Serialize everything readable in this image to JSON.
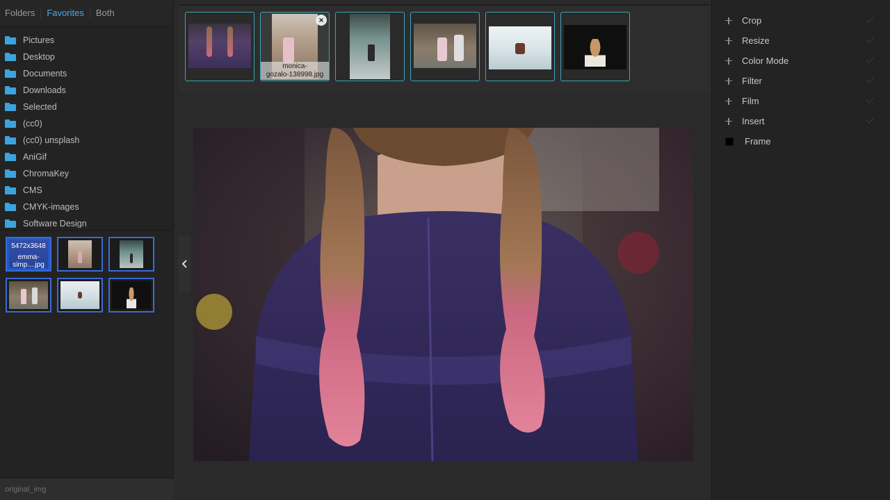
{
  "sidebar": {
    "tabs": [
      {
        "label": "Folders"
      },
      {
        "label": "Favorites"
      },
      {
        "label": "Both"
      }
    ],
    "active_tab": "Favorites",
    "folders": [
      {
        "label": "Pictures"
      },
      {
        "label": "Desktop"
      },
      {
        "label": "Documents"
      },
      {
        "label": "Downloads"
      },
      {
        "label": "Selected"
      },
      {
        "label": "(cc0)"
      },
      {
        "label": "(cc0) unsplash"
      },
      {
        "label": "AniGif"
      },
      {
        "label": "ChromaKey"
      },
      {
        "label": "CMS"
      },
      {
        "label": "CMYK-images"
      },
      {
        "label": "Software Design"
      }
    ],
    "favorites": {
      "selected_dimensions": "5472x3648",
      "selected_name": "emma-simp....jpg"
    },
    "status": "original_img"
  },
  "filmstrip": {
    "hover_caption_1": "monica-",
    "hover_caption_2": "gozalo-138998.jpg",
    "close_glyph": "×"
  },
  "right_panel": {
    "tools": [
      {
        "label": "Crop",
        "icon": "plus-icon"
      },
      {
        "label": "Resize",
        "icon": "plus-icon"
      },
      {
        "label": "Color Mode",
        "icon": "plus-icon"
      },
      {
        "label": "Filter",
        "icon": "plus-icon"
      },
      {
        "label": "Film",
        "icon": "plus-icon"
      },
      {
        "label": "Insert",
        "icon": "plus-icon"
      },
      {
        "label": "Frame",
        "icon": "black-square-icon"
      }
    ]
  },
  "colors": {
    "accent": "#4aa9e8",
    "folder": "#3ba4e0",
    "thumb_border": "#3aa6b9",
    "favorite_border": "#3a6bd6"
  }
}
